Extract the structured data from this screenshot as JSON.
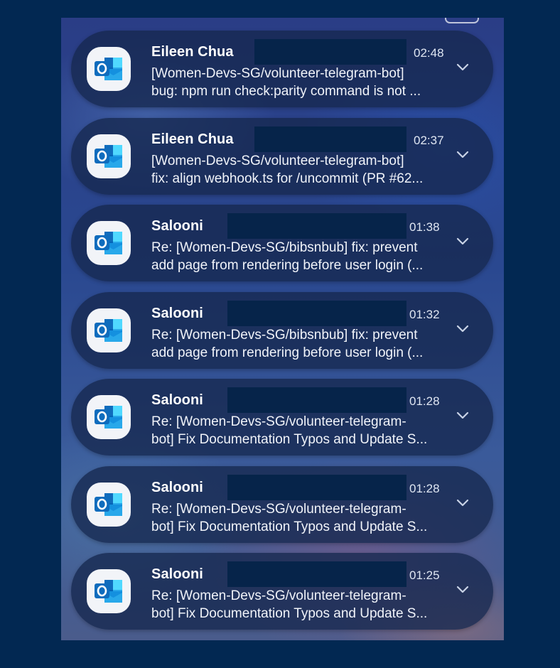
{
  "notifications": [
    {
      "app_icon": "outlook-icon",
      "sender": "Eileen Chua",
      "time": "02:48",
      "line1": "[Women-Devs-SG/volunteer-telegram-bot]",
      "line2": "bug: npm run check:parity command is not ...",
      "expand_icon": "chevron-down-icon"
    },
    {
      "app_icon": "outlook-icon",
      "sender": "Eileen Chua",
      "time": "02:37",
      "line1": "[Women-Devs-SG/volunteer-telegram-bot]",
      "line2": "fix: align webhook.ts for /uncommit (PR #62...",
      "expand_icon": "chevron-down-icon"
    },
    {
      "app_icon": "outlook-icon",
      "sender": "Salooni",
      "time": "01:38",
      "line1": "Re: [Women-Devs-SG/bibsnbub] fix: prevent",
      "line2": "add page from rendering before user login (...",
      "expand_icon": "chevron-down-icon"
    },
    {
      "app_icon": "outlook-icon",
      "sender": "Salooni",
      "time": "01:32",
      "line1": "Re: [Women-Devs-SG/bibsnbub] fix: prevent",
      "line2": "add page from rendering before user login (...",
      "expand_icon": "chevron-down-icon"
    },
    {
      "app_icon": "outlook-icon",
      "sender": "Salooni",
      "time": "01:28",
      "line1": "Re: [Women-Devs-SG/volunteer-telegram-",
      "line2": "bot] Fix Documentation Typos and Update S...",
      "expand_icon": "chevron-down-icon"
    },
    {
      "app_icon": "outlook-icon",
      "sender": "Salooni",
      "time": "01:28",
      "line1": "Re: [Women-Devs-SG/volunteer-telegram-",
      "line2": "bot] Fix Documentation Typos and Update S...",
      "expand_icon": "chevron-down-icon"
    },
    {
      "app_icon": "outlook-icon",
      "sender": "Salooni",
      "time": "01:25",
      "line1": "Re: [Women-Devs-SG/volunteer-telegram-",
      "line2": "bot] Fix Documentation Typos and Update S...",
      "expand_icon": "chevron-down-icon"
    }
  ],
  "colors": {
    "page_background": "#022852",
    "card_background": "#16284e",
    "redaction": "#06244a",
    "outlook_blue": "#0f6cbd",
    "outlook_light_blue": "#28a8ea"
  }
}
